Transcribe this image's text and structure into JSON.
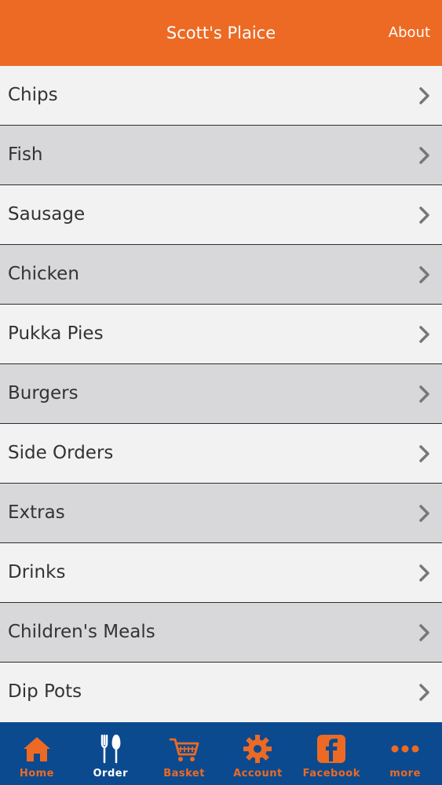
{
  "header": {
    "title": "Scott's Plaice",
    "about_label": "About"
  },
  "menu": {
    "items": [
      {
        "label": "Chips"
      },
      {
        "label": "Fish"
      },
      {
        "label": "Sausage"
      },
      {
        "label": "Chicken"
      },
      {
        "label": "Pukka Pies"
      },
      {
        "label": "Burgers"
      },
      {
        "label": "Side Orders"
      },
      {
        "label": "Extras"
      },
      {
        "label": "Drinks"
      },
      {
        "label": "Children's Meals"
      },
      {
        "label": "Dip Pots"
      }
    ]
  },
  "tabbar": {
    "tabs": [
      {
        "label": "Home",
        "icon": "home-icon"
      },
      {
        "label": "Order",
        "icon": "fork-knife-icon"
      },
      {
        "label": "Basket",
        "icon": "basket-icon"
      },
      {
        "label": "Account",
        "icon": "gear-icon"
      },
      {
        "label": "Facebook",
        "icon": "facebook-icon"
      },
      {
        "label": "more",
        "icon": "more-icon"
      }
    ],
    "active_tab": "Order"
  },
  "colors": {
    "brand_orange": "#ec6a24",
    "tabbar_blue": "#0b4a8f",
    "row_light": "#f2f2f2",
    "row_dark": "#d8d7d9"
  }
}
